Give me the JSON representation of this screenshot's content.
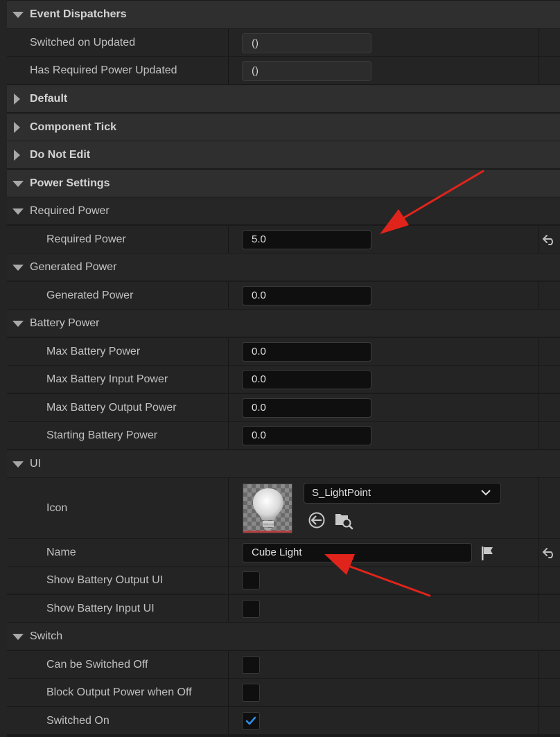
{
  "sections": {
    "event_dispatchers": "Event Dispatchers",
    "default": "Default",
    "component_tick": "Component Tick",
    "do_not_edit": "Do Not Edit",
    "power_settings": "Power Settings",
    "ui": "UI",
    "switch": "Switch"
  },
  "event_dispatchers": {
    "switched_on_updated": {
      "label": "Switched on Updated",
      "value": "()"
    },
    "has_required_power_updated": {
      "label": "Has Required Power Updated",
      "value": "()"
    }
  },
  "power_settings": {
    "required_power_group": "Required Power",
    "required_power": {
      "label": "Required Power",
      "value": "5.0"
    },
    "generated_power_group": "Generated Power",
    "generated_power": {
      "label": "Generated Power",
      "value": "0.0"
    },
    "battery_power_group": "Battery Power",
    "max_battery_power": {
      "label": "Max Battery Power",
      "value": "0.0"
    },
    "max_battery_input_power": {
      "label": "Max Battery Input Power",
      "value": "0.0"
    },
    "max_battery_output_power": {
      "label": "Max Battery Output Power",
      "value": "0.0"
    },
    "starting_battery_power": {
      "label": "Starting Battery Power",
      "value": "0.0"
    }
  },
  "ui": {
    "icon": {
      "label": "Icon",
      "asset": "S_LightPoint"
    },
    "name": {
      "label": "Name",
      "value": "Cube Light"
    },
    "show_battery_output_ui": {
      "label": "Show Battery Output UI",
      "checked": false
    },
    "show_battery_input_ui": {
      "label": "Show Battery Input UI",
      "checked": false
    }
  },
  "switch": {
    "can_be_switched_off": {
      "label": "Can be Switched Off",
      "checked": false
    },
    "block_output_power_when_off": {
      "label": "Block Output Power when Off",
      "checked": false
    },
    "switched_on": {
      "label": "Switched On",
      "checked": true
    }
  },
  "icons": {
    "expanded": "triangle-down-icon",
    "collapsed": "triangle-right-icon",
    "reset": "reset-arrow-icon",
    "browse": "browse-asset-icon",
    "use_selected": "use-selected-arrow-icon",
    "localize": "flag-icon",
    "check": "checkmark-icon"
  },
  "colors": {
    "annotation_arrow": "#e0241b",
    "checkmark": "#2f8fe6",
    "category_bg": "#2f2f2f",
    "field_bg": "#0f0f0f"
  }
}
